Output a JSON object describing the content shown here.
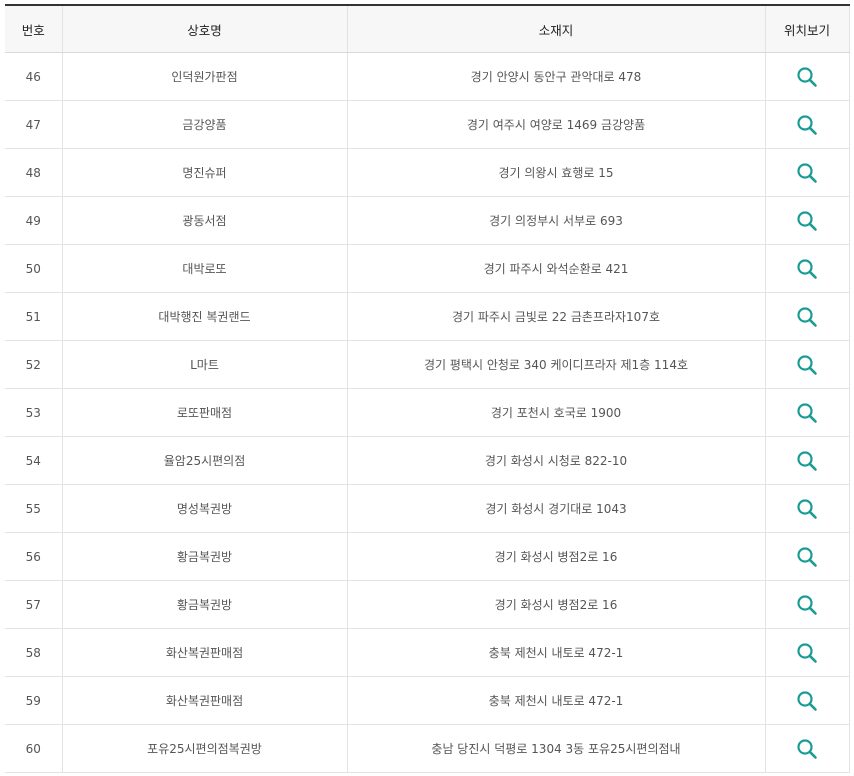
{
  "table": {
    "headers": {
      "no": "번호",
      "name": "상호명",
      "address": "소재지",
      "location": "위치보기"
    },
    "icon_color": "#1a9c94",
    "location_icon": "search-icon",
    "rows": [
      {
        "no": "46",
        "name": "인덕원가판점",
        "address": "경기 안양시 동안구 관악대로 478"
      },
      {
        "no": "47",
        "name": "금강양품",
        "address": "경기 여주시 여양로 1469 금강양품"
      },
      {
        "no": "48",
        "name": "명진슈퍼",
        "address": "경기 의왕시 효행로 15"
      },
      {
        "no": "49",
        "name": "광동서점",
        "address": "경기 의정부시 서부로 693"
      },
      {
        "no": "50",
        "name": "대박로또",
        "address": "경기 파주시 와석순환로 421"
      },
      {
        "no": "51",
        "name": "대박행진 복권랜드",
        "address": "경기 파주시 금빛로 22 금촌프라자107호"
      },
      {
        "no": "52",
        "name": "L마트",
        "address": "경기 평택시 안청로 340 케이디프라자 제1층 114호"
      },
      {
        "no": "53",
        "name": "로또판매점",
        "address": "경기 포천시 호국로 1900"
      },
      {
        "no": "54",
        "name": "율암25시편의점",
        "address": "경기 화성시 시청로 822-10"
      },
      {
        "no": "55",
        "name": "명성복권방",
        "address": "경기 화성시 경기대로 1043"
      },
      {
        "no": "56",
        "name": "황금복권방",
        "address": "경기 화성시 병점2로 16"
      },
      {
        "no": "57",
        "name": "황금복권방",
        "address": "경기 화성시 병점2로 16"
      },
      {
        "no": "58",
        "name": "화산복권판매점",
        "address": "충북 제천시 내토로 472-1"
      },
      {
        "no": "59",
        "name": "화산복권판매점",
        "address": "충북 제천시 내토로 472-1"
      },
      {
        "no": "60",
        "name": "포유25시편의점복권방",
        "address": "충남 당진시 덕평로 1304 3동 포유25시편의점내"
      }
    ]
  }
}
